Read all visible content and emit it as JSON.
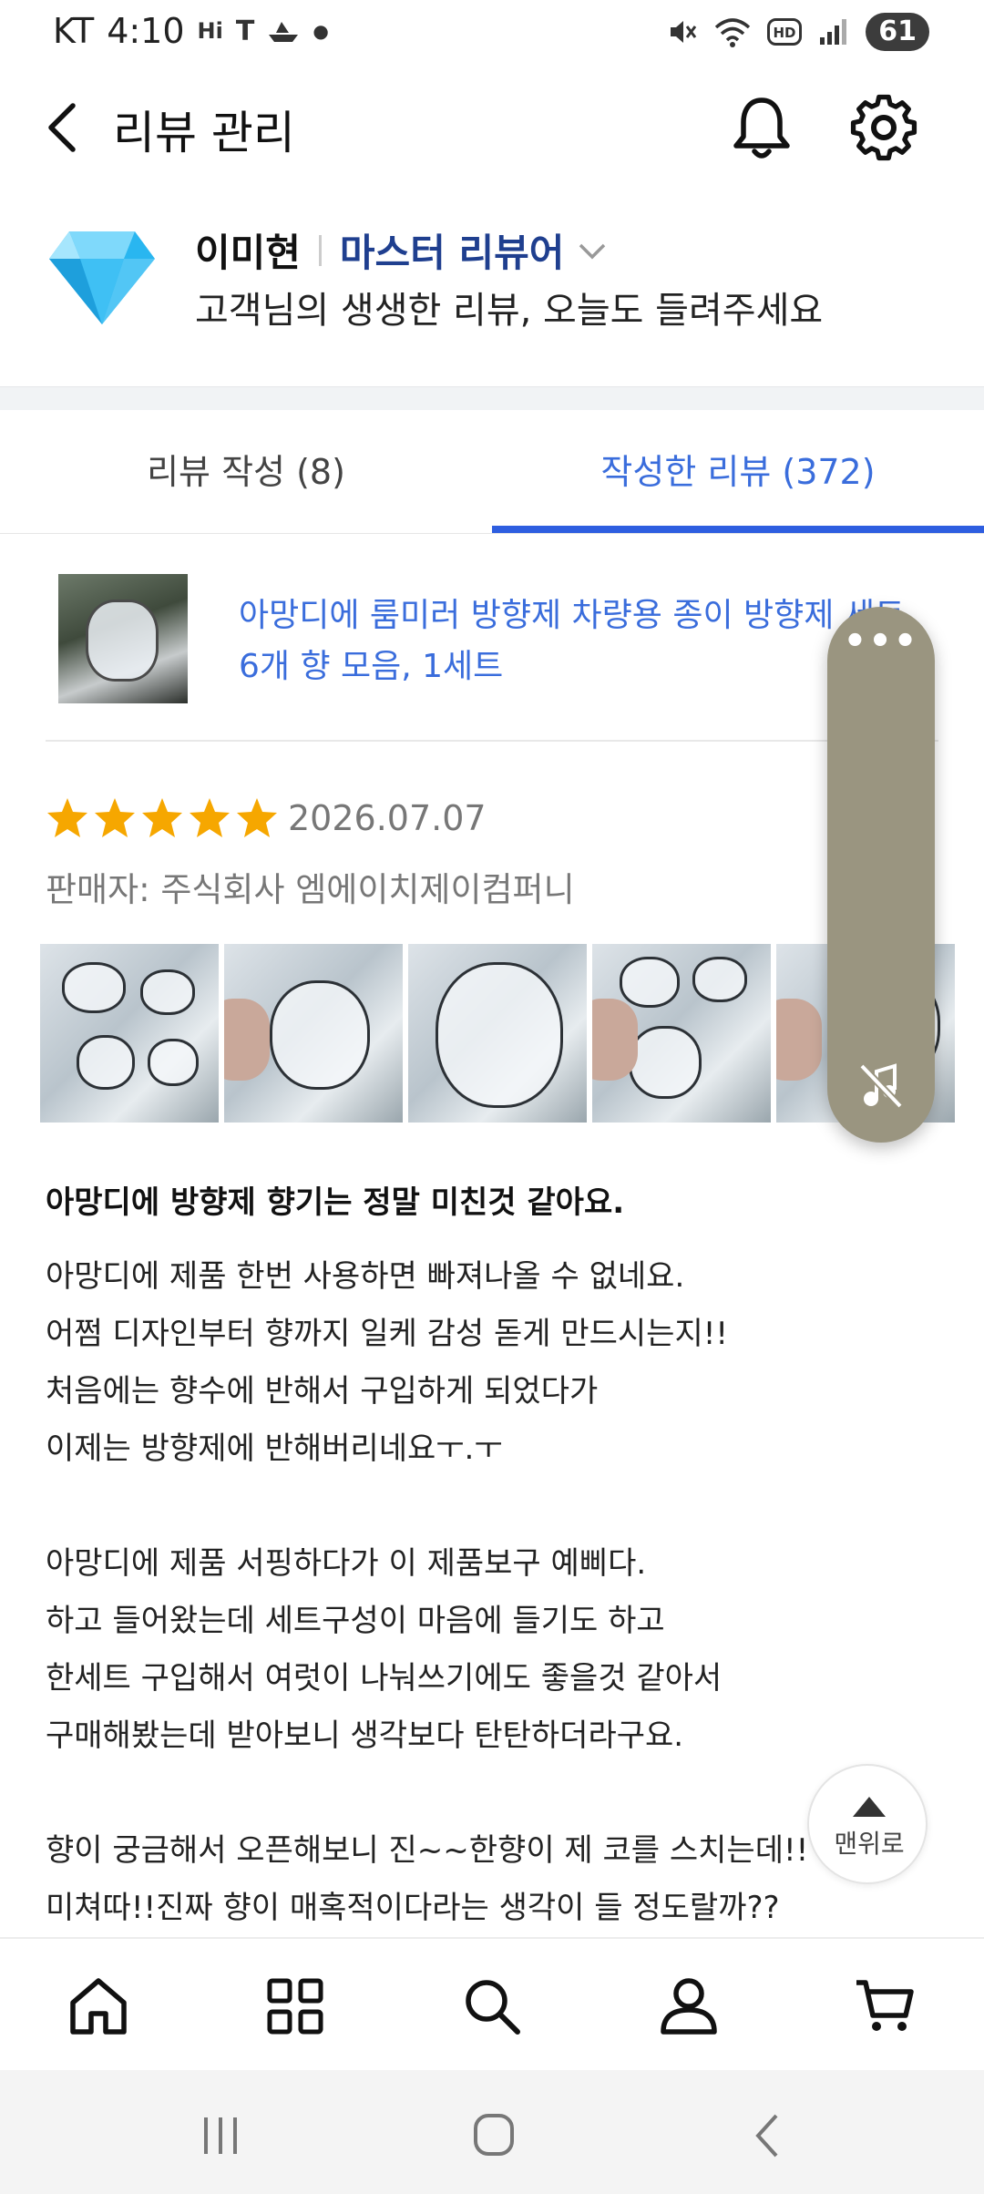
{
  "status_bar": {
    "carrier": "KT",
    "time": "4:10",
    "battery": "61",
    "icons": [
      "hi-icon",
      "t-icon",
      "boat-icon",
      "dot-icon",
      "mute-icon",
      "wifi-icon",
      "hd-icon",
      "signal-icon"
    ]
  },
  "header": {
    "title": "리뷰 관리",
    "icons": [
      "back-icon",
      "bell-icon",
      "gear-icon"
    ]
  },
  "profile": {
    "name": "이미현",
    "rank": "마스터 리뷰어",
    "subtitle": "고객님의 생생한 리뷰, 오늘도 들려주세요",
    "badge_icon": "diamond-icon"
  },
  "tabs": [
    {
      "label": "리뷰 작성 (8)",
      "active": false
    },
    {
      "label": "작성한 리뷰 (372)",
      "active": true
    }
  ],
  "product": {
    "name": "아망디에 룸미러 방향제 차량용 종이 방향제 세트 6개 향 모음, 1세트"
  },
  "review": {
    "rating": 5,
    "date": "2026.07.07",
    "seller": "판매자: 주식회사 엠에이치제이컴퍼니",
    "photo_count": 5,
    "title": "아망디에 방향제 향기는 정말 미친것 같아요.",
    "lines": [
      "아망디에 제품 한번 사용하면 빠져나올 수 없네요.",
      "어쩜 디자인부터 향까지 일케 감성 돋게 만드시는지!!",
      "처음에는 향수에 반해서 구입하게 되었다가",
      "이제는 방향제에 반해버리네요ㅜ.ㅜ",
      "",
      "아망디에 제품 서핑하다가 이 제품보구 예삐다.",
      "하고 들어왔는데 세트구성이 마음에 들기도 하고",
      "한세트 구입해서 여럿이 나눠쓰기에도 좋을것 같아서",
      "구매해봤는데 받아보니 생각보다 탄탄하더라구요.",
      "",
      "향이 궁금해서 오픈해보니 진~~한향이 제 코를 스치는데!!",
      "미쳐따!!진짜 향이 매혹적이다라는 생각이 들 정도랄까??"
    ]
  },
  "floating": {
    "more": "•••",
    "icon": "music-mute-icon"
  },
  "scroll_top": {
    "label": "맨위로"
  },
  "bottom_nav": [
    "home-icon",
    "categories-icon",
    "search-icon",
    "profile-icon",
    "cart-icon"
  ],
  "system_nav": [
    "recents-icon",
    "home-circle-icon",
    "back-arrow-icon"
  ],
  "colors": {
    "accent_blue": "#3a6ddc",
    "rank_navy": "#1f3f8f",
    "star_gold": "#f6a700",
    "floating_panel": "#9a9580"
  }
}
